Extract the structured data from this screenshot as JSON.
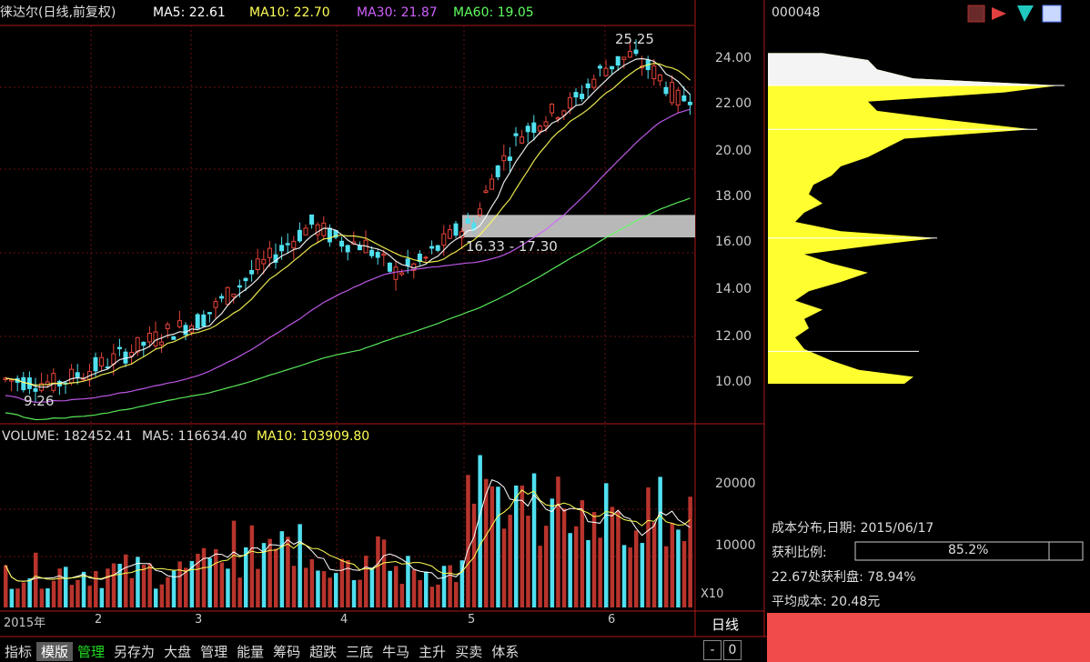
{
  "header": {
    "title": "徕达尔(日线,前复权)",
    "ma5": "MA5: 22.61",
    "ma10": "MA10: 22.70",
    "ma30": "MA30: 21.87",
    "ma60": "MA60: 19.05",
    "code": "000048",
    "colors": {
      "title": "#e0e0e0",
      "ma5": "#ffffff",
      "ma10": "#ffff55",
      "ma30": "#d060ff",
      "ma60": "#60ff60"
    }
  },
  "price_axis": {
    "ticks": [
      "24.00",
      "22.00",
      "20.00",
      "18.00",
      "16.00",
      "14.00",
      "12.00",
      "10.00"
    ]
  },
  "annotations": {
    "high": "25.25",
    "low": "9.26",
    "range": "16.33 - 17.30"
  },
  "volume": {
    "label": "VOLUME: 182452.41",
    "ma5": "MA5: 116634.40",
    "ma10": "MA10: 103909.80",
    "ticks": [
      "20000",
      "10000"
    ],
    "unit": "X10"
  },
  "date_axis": {
    "labels": [
      "2015年",
      "2",
      "3",
      "4",
      "5",
      "6"
    ],
    "period": "日线"
  },
  "cost_distribution": {
    "title": "成本分布,日期: 2015/06/17",
    "profit_ratio_label": "获利比例:",
    "profit_ratio_value": "85.2%",
    "profit_ratio": 0.852,
    "profit_at_price": "22.67处获利盘: 78.94%",
    "avg_cost": "平均成本: 20.48元"
  },
  "scroll": {
    "minus": "-",
    "zero": "0"
  },
  "toolbar": {
    "tabs": [
      "指标",
      "模版",
      "管理",
      "另存为",
      "大盘",
      "管理",
      "能量",
      "筹码",
      "超跌",
      "三底",
      "牛马",
      "主升",
      "买卖",
      "体系"
    ]
  },
  "colors": {
    "up": "#e8443a",
    "down": "#50e0f0",
    "yellow": "#ffff30",
    "band": "#b8b8b8",
    "red_panel": "#f24b4b"
  },
  "chart_data": {
    "type": "candlestick",
    "x_labels": [
      "2015年",
      "2",
      "3",
      "4",
      "5",
      "6"
    ],
    "price_ylim": [
      9,
      25.5
    ],
    "volume_ylim": [
      0,
      25000
    ],
    "volume_ma5": 116634.4,
    "volume_ma10": 103909.8,
    "volume_last": 182452.41,
    "high": 25.25,
    "low": 9.26,
    "ma_latest": {
      "MA5": 22.61,
      "MA10": 22.7,
      "MA30": 21.87,
      "MA60": 19.05
    },
    "band": [
      16.33,
      17.3
    ],
    "avg_cost": 20.48
  }
}
